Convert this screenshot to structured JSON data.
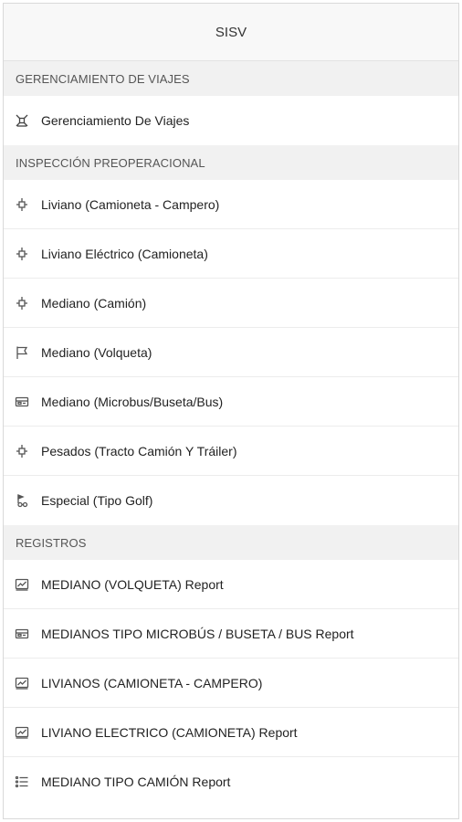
{
  "header": {
    "title": "SISV"
  },
  "sections": [
    {
      "title": "GERENCIAMIENTO DE VIAJES",
      "items": [
        {
          "label": "Gerenciamiento De Viajes",
          "icon": "cross-tools-icon"
        }
      ]
    },
    {
      "title": "INSPECCIÓN PREOPERACIONAL",
      "items": [
        {
          "label": "Liviano (Camioneta - Campero)",
          "icon": "gear-plus-icon"
        },
        {
          "label": "Liviano Eléctrico (Camioneta)",
          "icon": "gear-plus-icon"
        },
        {
          "label": "Mediano (Camión)",
          "icon": "gear-plus-icon"
        },
        {
          "label": "Mediano (Volqueta)",
          "icon": "flag-icon"
        },
        {
          "label": "Mediano (Microbus/Buseta/Bus)",
          "icon": "bus-icon"
        },
        {
          "label": "Pesados (Tracto Camión Y Tráiler)",
          "icon": "gear-plus-icon"
        },
        {
          "label": "Especial (Tipo Golf)",
          "icon": "golf-icon"
        }
      ]
    },
    {
      "title": "REGISTROS",
      "items": [
        {
          "label": "MEDIANO (VOLQUETA) Report",
          "icon": "report-icon"
        },
        {
          "label": "MEDIANOS TIPO MICROBÚS / BUSETA / BUS Report",
          "icon": "bus-icon"
        },
        {
          "label": "LIVIANOS (CAMIONETA - CAMPERO)",
          "icon": "report-icon"
        },
        {
          "label": "LIVIANO ELECTRICO (CAMIONETA) Report",
          "icon": "report-icon"
        },
        {
          "label": "MEDIANO TIPO CAMIÓN Report",
          "icon": "list-icon"
        }
      ]
    }
  ]
}
